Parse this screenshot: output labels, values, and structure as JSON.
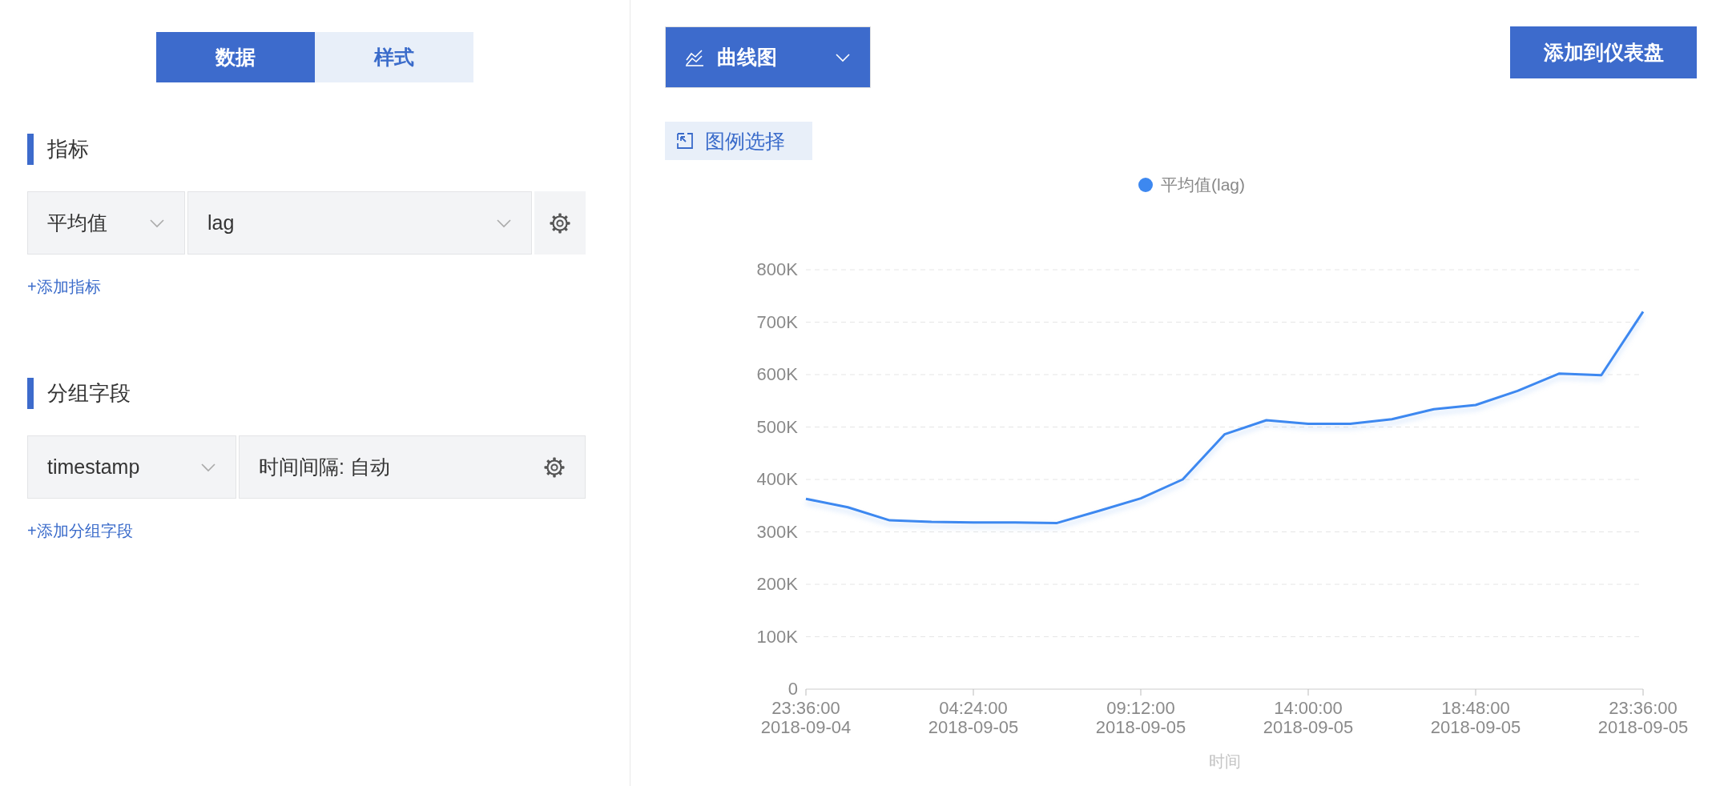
{
  "tabs": [
    {
      "label": "数据",
      "selected": true
    },
    {
      "label": "样式",
      "selected": false
    }
  ],
  "sections": [
    {
      "title": "指标",
      "row": [
        {
          "kind": "select",
          "value": "平均值"
        },
        {
          "kind": "select",
          "value": "lag"
        },
        {
          "kind": "gear"
        }
      ],
      "add_link": "+添加指标"
    },
    {
      "title": "分组字段",
      "row": [
        {
          "kind": "select",
          "value": "timestamp"
        },
        {
          "kind": "text-gear",
          "value": "时间间隔: 自动"
        }
      ],
      "add_link": "+添加分组字段"
    }
  ],
  "chart_type": {
    "label": "曲线图"
  },
  "add_to_dashboard": "添加到仪表盘",
  "legend_select": "图例选择",
  "chart_data": {
    "type": "line",
    "xlabel": "时间",
    "categories": [
      "23:36:00\n2018-09-04",
      null,
      null,
      null,
      "04:24:00\n2018-09-05",
      null,
      null,
      null,
      "09:12:00\n2018-09-05",
      null,
      null,
      null,
      "14:00:00\n2018-09-05",
      null,
      null,
      null,
      "18:48:00\n2018-09-05",
      null,
      null,
      null,
      "23:36:00\n2018-09-05"
    ],
    "series": [
      {
        "name": "平均值(lag)",
        "color": "#3d88f0",
        "values": [
          363000,
          347000,
          322000,
          319000,
          318000,
          318000,
          317000,
          340000,
          364000,
          400000,
          486000,
          513000,
          506000,
          506000,
          515000,
          534000,
          542000,
          569000,
          602000,
          599000,
          720000
        ]
      }
    ],
    "ylim": [
      0,
      800000
    ],
    "grid": true,
    "yticks": [
      {
        "value": 0,
        "label": "0"
      },
      {
        "value": 100000,
        "label": "100K"
      },
      {
        "value": 200000,
        "label": "200K"
      },
      {
        "value": 300000,
        "label": "300K"
      },
      {
        "value": 400000,
        "label": "400K"
      },
      {
        "value": 500000,
        "label": "500K"
      },
      {
        "value": 600000,
        "label": "600K"
      },
      {
        "value": 700000,
        "label": "700K"
      },
      {
        "value": 800000,
        "label": "800K"
      }
    ]
  }
}
